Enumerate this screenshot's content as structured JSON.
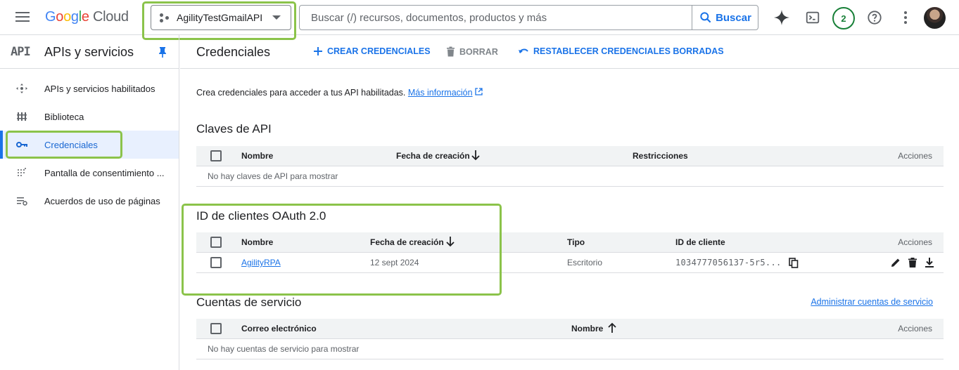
{
  "header": {
    "logo_google": "Google",
    "logo_cloud": "Cloud",
    "project_name": "AgilityTestGmailAPI",
    "search_placeholder": "Buscar (/) recursos, documentos, productos y más",
    "search_button": "Buscar",
    "notifications_count": "2"
  },
  "sidebar": {
    "logo_text": "API",
    "title": "APIs y servicios",
    "items": [
      {
        "label": "APIs y servicios habilitados",
        "icon": "apis-icon"
      },
      {
        "label": "Biblioteca",
        "icon": "library-icon"
      },
      {
        "label": "Credenciales",
        "icon": "key-icon",
        "active": true
      },
      {
        "label": "Pantalla de consentimiento ...",
        "icon": "consent-icon"
      },
      {
        "label": "Acuerdos de uso de páginas",
        "icon": "settings-list-icon"
      }
    ]
  },
  "main": {
    "title": "Credenciales",
    "actions": {
      "create": "CREAR CREDENCIALES",
      "delete": "BORRAR",
      "restore": "RESTABLECER CREDENCIALES BORRADAS"
    },
    "intro_text": "Crea credenciales para acceder a tus API habilitadas.",
    "intro_link": "Más información",
    "api_keys": {
      "title": "Claves de API",
      "columns": [
        "Nombre",
        "Fecha de creación",
        "Restricciones",
        "Acciones"
      ],
      "empty": "No hay claves de API para mostrar"
    },
    "oauth": {
      "title": "ID de clientes OAuth 2.0",
      "columns": [
        "Nombre",
        "Fecha de creación",
        "Tipo",
        "ID de cliente",
        "Acciones"
      ],
      "rows": [
        {
          "name": "AgilityRPA",
          "created": "12 sept 2024",
          "type": "Escritorio",
          "client_id": "1034777056137-5r5..."
        }
      ]
    },
    "service_accounts": {
      "title": "Cuentas de servicio",
      "manage_link": "Administrar cuentas de servicio",
      "columns": [
        "Correo electrónico",
        "Nombre",
        "Acciones"
      ],
      "empty": "No hay cuentas de servicio para mostrar"
    }
  },
  "colors": {
    "accent": "#1a73e8",
    "highlight": "#8bc34a",
    "badge": "#188038"
  }
}
